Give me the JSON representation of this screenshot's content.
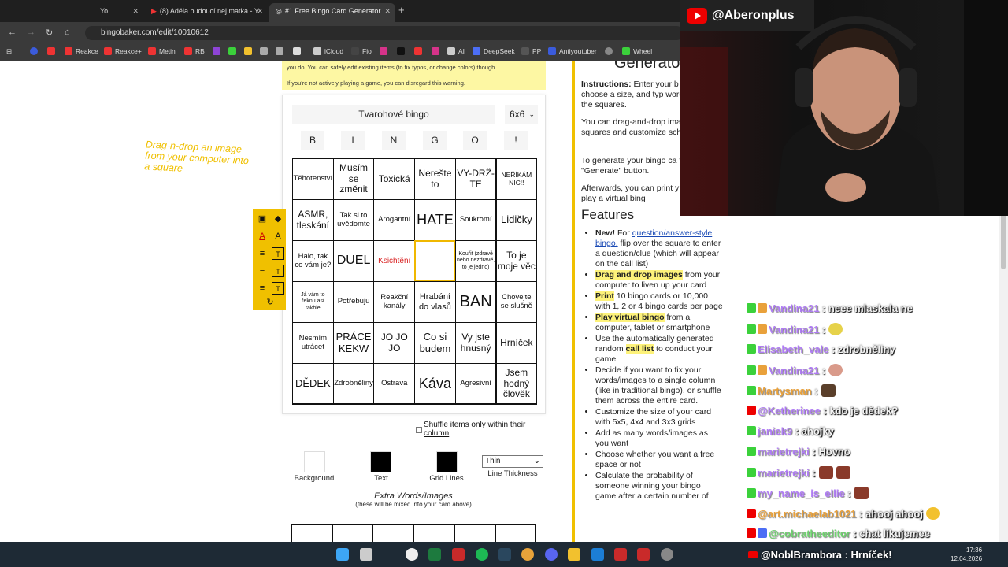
{
  "browser": {
    "tabs": [
      {
        "label": "…Yo",
        "active": false
      },
      {
        "label": "(8) Adéla budoucí nej matka - Y",
        "active": false
      },
      {
        "label": "#1 Free Bingo Card Generator",
        "active": true
      }
    ],
    "new_tab": "+",
    "url": "bingobaker.com/edit/10010612",
    "bookmarks": [
      "Reakce",
      "Reakce+",
      "Metin",
      "RB",
      "iCloud",
      "Fio",
      "AI",
      "DeepSeek",
      "PP",
      "Antiyoutuber",
      "Wheel"
    ]
  },
  "warning": {
    "line1": "you do. You can safely edit existing items (to fix typos, or change colors) though.",
    "line2": "If you're not actively playing a game, you can disregard this warning."
  },
  "editor": {
    "title": "Tvarohové bingo",
    "size": "6x6",
    "headers": [
      "B",
      "I",
      "N",
      "G",
      "O",
      "!"
    ],
    "drag_hint": "Drag-n-drop an image from your computer into a square",
    "cells": [
      [
        "Těhotenství",
        "Musím se změnit",
        "Toxická",
        "Nerešte to",
        "VY-DRŽ-TE",
        "NEŘÍKÁM NIC!!"
      ],
      [
        "ASMR, tleskání",
        "Tak si to uvědomte",
        "Arogantní",
        "HATE",
        "Soukromí",
        "Lidičky"
      ],
      [
        "Halo, tak co vám je?",
        "DUEL",
        "Ksichtění",
        "|",
        "Kouřit (zdravě nebo nezdravě, to je jedno)",
        "To je moje věc"
      ],
      [
        "Já vám to řeknu asi takhle",
        "Potřebuju",
        "Reakční kanály",
        "Hrabání do vlasů",
        "BAN",
        "Chovejte se slušně"
      ],
      [
        "Nesmím utrácet",
        "PRÁCE KEKW",
        "JO JO JO",
        "Co si budem",
        "Vy jste hnusný",
        "Hrníček"
      ],
      [
        "DĚDEK",
        "Zdrobněliny",
        "Ostrava",
        "Káva",
        "Agresivní",
        "Jsem hodný člověk"
      ]
    ],
    "shuffle_label": "Shuffle items only within their column",
    "swatches": [
      {
        "label": "Background",
        "color": "#ffffff"
      },
      {
        "label": "Text",
        "color": "#000000"
      },
      {
        "label": "Grid Lines",
        "color": "#000000"
      }
    ],
    "line_thickness": {
      "value": "Thin",
      "label": "Line Thickness"
    },
    "extra_title": "Extra Words/Images",
    "extra_sub": "(these will be mixed into your card above)"
  },
  "info": {
    "generator": "Generato",
    "instructions_bold": "Instructions:",
    "instructions": "Enter your b title, choose a size, and typ words into the squares.",
    "p2": "You can drag-and-drop ima the squares and customize scheme.",
    "p3": "To generate your bingo ca the \"Generate\" button.",
    "p4": "Afterwards, you can print y cards, or play a virtual bing",
    "features_title": "Features",
    "features": [
      {
        "pre": "New!",
        "text": " For ",
        "link": "question/answer-style bingo,",
        "rest": " flip over the square to enter a question/clue (which will appear on the call list)"
      },
      {
        "hl": "Drag and drop images",
        "rest": " from your computer to liven up your card"
      },
      {
        "hl": "Print",
        "rest": " 10 bingo cards or 10,000 with 1, 2 or 4 bingo cards per page"
      },
      {
        "hl": "Play virtual bingo",
        "rest": " from a computer, tablet or smartphone"
      },
      {
        "rest": "Use the automatically generated random ",
        "hl2": "call list",
        "rest2": " to conduct your game"
      },
      {
        "rest": "Decide if you want to fix your words/images to a single column (like in traditional bingo), or shuffle them across the entire card."
      },
      {
        "rest": "Customize the size of your card with 5x5, 4x4 and 3x3 grids"
      },
      {
        "rest": "Add as many words/images as you want"
      },
      {
        "rest": "Choose whether you want a free space or not"
      },
      {
        "rest": "Calculate the probability of someone winning your bingo game after a certain number of"
      }
    ]
  },
  "stream": {
    "channel": "@Aberonplus",
    "chat": [
      {
        "user": "Vandina21",
        "text": ": neee mlaskala ne",
        "color": "#b07cf5"
      },
      {
        "user": "Vandina21",
        "text": ":",
        "color": "#b07cf5",
        "emote": "#e6d24a"
      },
      {
        "user": "Elisabeth_vale",
        "text": ": zdrobněliny",
        "color": "#b07cf5"
      },
      {
        "user": "Vandina21",
        "text": ":",
        "color": "#b07cf5",
        "emote": "#d99a8a"
      },
      {
        "user": "Martysman",
        "text": ":",
        "color": "#e9a13b",
        "emote": "#5a3f2a"
      },
      {
        "user": "@Ketherinee",
        "text": ": kdo je dědek?",
        "color": "#b07cf5"
      },
      {
        "user": "janiek9",
        "text": ": ahojky",
        "color": "#b07cf5"
      },
      {
        "user": "marietrejki",
        "text": ": Hovno",
        "color": "#b07cf5"
      },
      {
        "user": "marietrejki",
        "text": ":",
        "color": "#b07cf5",
        "emote": "#8a3a2a"
      },
      {
        "user": "my_name_is_ellie",
        "text": ":",
        "color": "#b07cf5",
        "emote": "#8a3a2a"
      },
      {
        "user": "@art.michaelab1021",
        "text": ": ahooj ahooj",
        "color": "#e9a13b",
        "emote": "#f2c12e"
      },
      {
        "user": "@cobratheeditor",
        "text": ": chat likujemee",
        "color": "#6fd26f"
      }
    ],
    "banner": "@NoblBrambora : Hrníček!"
  },
  "taskbar": {
    "time": "17:36",
    "date": "12.04.2026"
  }
}
